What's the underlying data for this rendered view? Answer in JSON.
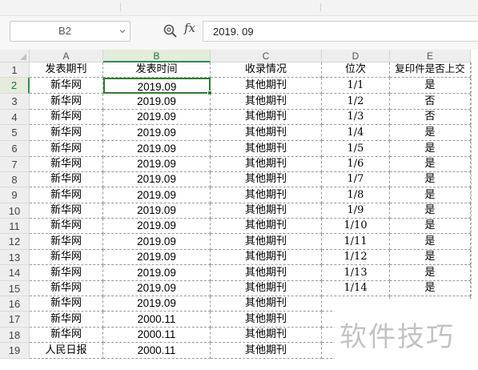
{
  "formula_bar": {
    "cell_ref": "B2",
    "fx_label": "fx",
    "formula_value": "2019. 09"
  },
  "columns": [
    "A",
    "B",
    "C",
    "D",
    "E"
  ],
  "active_column": "B",
  "header_row": {
    "row": "1",
    "cells": [
      "发表期刊",
      "发表时间",
      "收录情况",
      "位次",
      "复印件是否上交"
    ]
  },
  "rows": [
    {
      "row": "2",
      "cells": [
        "新华网",
        "2019.09",
        "其他期刊",
        "1/1",
        "是"
      ]
    },
    {
      "row": "3",
      "cells": [
        "新华网",
        "2019.09",
        "其他期刊",
        "1/2",
        "否"
      ]
    },
    {
      "row": "4",
      "cells": [
        "新华网",
        "2019.09",
        "其他期刊",
        "1/3",
        "否"
      ]
    },
    {
      "row": "5",
      "cells": [
        "新华网",
        "2019.09",
        "其他期刊",
        "1/4",
        "是"
      ]
    },
    {
      "row": "6",
      "cells": [
        "新华网",
        "2019.09",
        "其他期刊",
        "1/5",
        "是"
      ]
    },
    {
      "row": "7",
      "cells": [
        "新华网",
        "2019.09",
        "其他期刊",
        "1/6",
        "是"
      ]
    },
    {
      "row": "8",
      "cells": [
        "新华网",
        "2019.09",
        "其他期刊",
        "1/7",
        "是"
      ]
    },
    {
      "row": "9",
      "cells": [
        "新华网",
        "2019.09",
        "其他期刊",
        "1/8",
        "是"
      ]
    },
    {
      "row": "10",
      "cells": [
        "新华网",
        "2019.09",
        "其他期刊",
        "1/9",
        "是"
      ]
    },
    {
      "row": "11",
      "cells": [
        "新华网",
        "2019.09",
        "其他期刊",
        "1/10",
        "是"
      ]
    },
    {
      "row": "12",
      "cells": [
        "新华网",
        "2019.09",
        "其他期刊",
        "1/11",
        "是"
      ]
    },
    {
      "row": "13",
      "cells": [
        "新华网",
        "2019.09",
        "其他期刊",
        "1/12",
        "是"
      ]
    },
    {
      "row": "14",
      "cells": [
        "新华网",
        "2019.09",
        "其他期刊",
        "1/13",
        "是"
      ]
    },
    {
      "row": "15",
      "cells": [
        "新华网",
        "2019.09",
        "其他期刊",
        "1/14",
        "是"
      ]
    },
    {
      "row": "16",
      "cells": [
        "新华网",
        "2019.09",
        "其他期刊",
        "",
        ""
      ]
    },
    {
      "row": "17",
      "cells": [
        "新华网",
        "2000.11",
        "其他期刊",
        "",
        ""
      ]
    },
    {
      "row": "18",
      "cells": [
        "新华网",
        "2000.11",
        "其他期刊",
        "",
        ""
      ]
    },
    {
      "row": "19",
      "cells": [
        "人民日报",
        "2000.11",
        "其他期刊",
        "",
        ""
      ]
    }
  ],
  "selected_cell": "B2",
  "watermark": "软件技巧",
  "colors": {
    "selection": "#2e7d32",
    "header_bg": "#eeeeee",
    "active_header_bg": "#e4ecdc"
  }
}
